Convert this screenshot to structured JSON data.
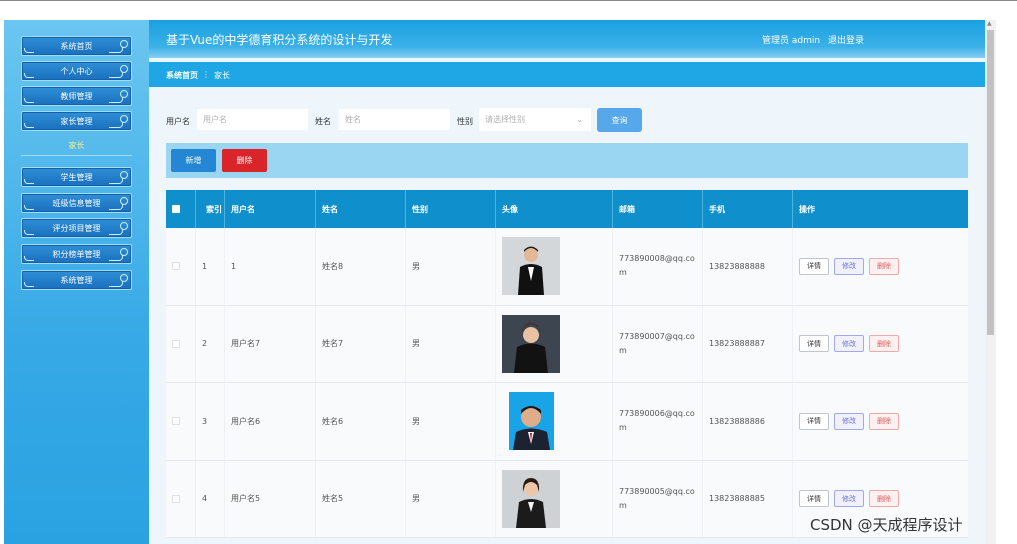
{
  "app": {
    "title": "基于Vue的中学德育积分系统的设计与开发",
    "admin_label": "管理员 admin",
    "logout_label": "退出登录"
  },
  "sidebar": {
    "items": [
      {
        "label": "系统首页"
      },
      {
        "label": "个人中心"
      },
      {
        "label": "教师管理"
      },
      {
        "label": "家长管理"
      },
      {
        "label": "学生管理"
      },
      {
        "label": "班级信息管理"
      },
      {
        "label": "评分项目管理"
      },
      {
        "label": "积分榜单管理"
      },
      {
        "label": "系统管理"
      }
    ],
    "sub_label": "家长"
  },
  "breadcrumb": {
    "home": "系统首页",
    "sep": "⋮",
    "current": "家长"
  },
  "search": {
    "username_label": "用户名",
    "username_placeholder": "用户名",
    "name_label": "姓名",
    "name_placeholder": "姓名",
    "gender_label": "性别",
    "gender_placeholder": "请选择性别",
    "query_label": "查询"
  },
  "toolbar": {
    "add_label": "新增",
    "delete_label": "删除"
  },
  "table": {
    "headers": {
      "index": "索引",
      "username": "用户名",
      "name": "姓名",
      "gender": "性别",
      "avatar": "头像",
      "email": "邮箱",
      "phone": "手机",
      "actions": "操作"
    },
    "rows": [
      {
        "index": "1",
        "username": "1",
        "name": "姓名8",
        "gender": "男",
        "email": "773890008@qq.com",
        "phone": "13823888888",
        "avatar": "man-in-suit"
      },
      {
        "index": "2",
        "username": "用户名7",
        "name": "姓名7",
        "gender": "男",
        "email": "773890007@qq.com",
        "phone": "13823888887",
        "avatar": "woman-in-black"
      },
      {
        "index": "3",
        "username": "用户名6",
        "name": "姓名6",
        "gender": "男",
        "email": "773890006@qq.com",
        "phone": "13823888886",
        "avatar": "man-blue-background"
      },
      {
        "index": "4",
        "username": "用户名5",
        "name": "姓名5",
        "gender": "男",
        "email": "773890005@qq.com",
        "phone": "13823888885",
        "avatar": "woman-in-suit"
      }
    ],
    "actions": {
      "detail": "详情",
      "edit": "修改",
      "delete": "删除"
    }
  },
  "watermark": "CSDN @天成程序设计",
  "colors": {
    "header": "#1aa0e0",
    "sidebar": "#37a9e6",
    "add_button": "#2587d4",
    "delete_button": "#d9242a",
    "table_header": "#0f8fcb"
  }
}
